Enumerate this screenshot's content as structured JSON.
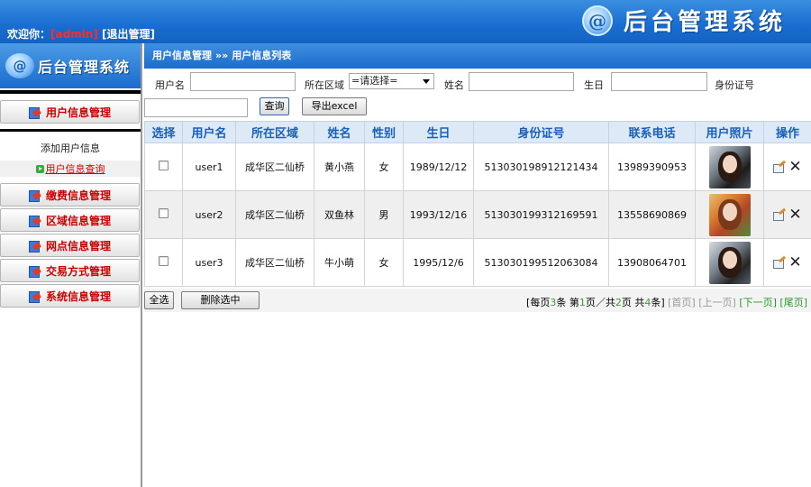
{
  "header": {
    "welcome_prefix": "欢迎你：",
    "username": "[admin]",
    "logout": "[退出管理]",
    "system_title": "后台管理系统",
    "logo_glyph": "@"
  },
  "sidebar": {
    "logo_title": "后台管理系统",
    "menu": [
      {
        "label": "用户信息管理",
        "icon": "user-manage-icon"
      },
      {
        "label": "缴费信息管理",
        "icon": "payment-icon"
      },
      {
        "label": "区域信息管理",
        "icon": "region-icon"
      },
      {
        "label": "网点信息管理",
        "icon": "outlet-icon"
      },
      {
        "label": "交易方式管理",
        "icon": "transaction-icon"
      },
      {
        "label": "系统信息管理",
        "icon": "system-icon"
      }
    ],
    "submenu": {
      "add_user": "添加用户信息",
      "query_user": "用户信息查询"
    }
  },
  "breadcrumb": {
    "section": "用户信息管理",
    "separator": "»»",
    "page": "用户信息列表"
  },
  "search": {
    "username_label": "用户名",
    "username_value": "",
    "region_label": "所在区域",
    "region_selected": "=请选择=",
    "name_label": "姓名",
    "name_value": "",
    "birthday_label": "生日",
    "birthday_value": "",
    "idcard_label": "身份证号",
    "idcard_value": "",
    "query_button": "查询",
    "export_button": "导出excel"
  },
  "table": {
    "headers": [
      "选择",
      "用户名",
      "所在区域",
      "姓名",
      "性别",
      "生日",
      "身份证号",
      "联系电话",
      "用户照片",
      "操作"
    ],
    "rows": [
      {
        "username": "user1",
        "region": "成华区二仙桥",
        "name": "黄小燕",
        "gender": "女",
        "birthday": "1989/12/12",
        "idcard": "513030198912121434",
        "phone": "13989390953"
      },
      {
        "username": "user2",
        "region": "成华区二仙桥",
        "name": "双鱼林",
        "gender": "男",
        "birthday": "1993/12/16",
        "idcard": "513030199312169591",
        "phone": "13558690869"
      },
      {
        "username": "user3",
        "region": "成华区二仙桥",
        "name": "牛小萌",
        "gender": "女",
        "birthday": "1995/12/6",
        "idcard": "513030199512063084",
        "phone": "13908064701"
      }
    ]
  },
  "footer": {
    "select_all": "全选",
    "delete_selected": "删除选中",
    "pager": {
      "per_page_prefix": "[每页",
      "per_page": "3",
      "per_page_suffix": "条",
      "page_prefix": "第",
      "current_page": "1",
      "page_mid": "页／共",
      "total_pages": "2",
      "page_suffix": "页",
      "total_prefix": "共",
      "total": "4",
      "total_suffix": "条]",
      "first": "[首页]",
      "prev": "[上一页]",
      "next": "[下一页]",
      "last": "[尾页]"
    }
  },
  "colors": {
    "header_blue": "#1a6fd2",
    "menu_red": "#cc0000",
    "table_header_text": "#1a5fb8",
    "pager_green": "#2a9a2a"
  }
}
